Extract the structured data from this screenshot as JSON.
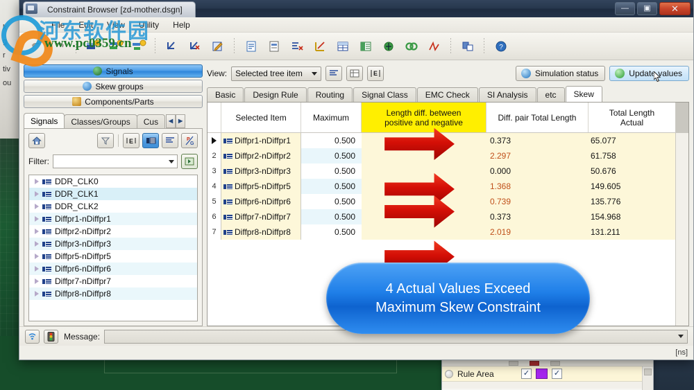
{
  "window": {
    "title": "Constraint Browser [zd-mother.dsgn]",
    "app_icon": "constraint-browser-icon",
    "controls": {
      "minimize": "—",
      "maximize": "▣",
      "close": "✕"
    }
  },
  "menu": {
    "items": [
      "File",
      "Edit",
      "View",
      "Utility",
      "Help"
    ]
  },
  "toolbar": {
    "groups": [
      {
        "buttons": [
          {
            "name": "undo-icon",
            "glyph": "↶"
          },
          {
            "name": "redo-icon",
            "glyph": "↷"
          }
        ]
      },
      {
        "buttons": [
          {
            "name": "new-constraint-icon",
            "glyph": "⚑"
          },
          {
            "name": "edit-constraint-icon",
            "glyph": "⚒"
          },
          {
            "name": "apply-constraint-icon",
            "glyph": "⚐"
          }
        ]
      },
      {
        "buttons": [
          {
            "name": "check-rule-icon",
            "glyph": "✓"
          },
          {
            "name": "clear-rule-icon",
            "glyph": "✗"
          },
          {
            "name": "edit-rule-icon",
            "glyph": "✎"
          }
        ]
      },
      {
        "buttons": [
          {
            "name": "import-icon",
            "glyph": "⇥"
          },
          {
            "name": "export-icon",
            "glyph": "↧"
          },
          {
            "name": "delete-rule-icon",
            "glyph": "✖"
          },
          {
            "name": "length-chart-icon",
            "glyph": "↗"
          },
          {
            "name": "table-view-icon",
            "glyph": "▦"
          },
          {
            "name": "group-view-icon",
            "glyph": "▤"
          },
          {
            "name": "net-icon",
            "glyph": "●"
          },
          {
            "name": "link-net-icon",
            "glyph": "⚭"
          },
          {
            "name": "waveform-icon",
            "glyph": "⌒"
          }
        ]
      },
      {
        "buttons": [
          {
            "name": "layout-icon",
            "glyph": "◫"
          }
        ]
      },
      {
        "buttons": [
          {
            "name": "help-icon",
            "glyph": "?"
          }
        ]
      }
    ]
  },
  "sidebar": {
    "mode_buttons": [
      {
        "label": "Signals",
        "icon": "signals-icon",
        "selected": true,
        "color": "#2f6f3f"
      },
      {
        "label": "Skew groups",
        "icon": "clock-icon",
        "selected": false,
        "color": "#2e79c4"
      },
      {
        "label": "Components/Parts",
        "icon": "component-icon",
        "selected": false,
        "color": "#d08a20"
      }
    ],
    "tabs": [
      {
        "label": "Signals",
        "active": true
      },
      {
        "label": "Classes/Groups",
        "active": false
      },
      {
        "label": "Cus",
        "active": false
      }
    ],
    "tab_scroll": {
      "prev": "◀",
      "next": "▶"
    },
    "tools": [
      {
        "name": "home-button",
        "glyph": "⌂",
        "active": false
      },
      {
        "name": "filter-button",
        "glyph": "∇",
        "active": false
      },
      {
        "name": "expand-all-button",
        "glyph": "E",
        "active": false
      },
      {
        "name": "net-view-button",
        "glyph": "▤",
        "active": true
      },
      {
        "name": "list-view-button",
        "glyph": "≣",
        "active": false
      },
      {
        "name": "pg-toggle-button",
        "glyph": "P/G",
        "active": false
      }
    ],
    "filter": {
      "label": "Filter:",
      "value": "",
      "placeholder": "",
      "apply_icon": "apply-filter-icon"
    },
    "tree_items": [
      {
        "label": "DDR_CLK0",
        "highlighted": false
      },
      {
        "label": "DDR_CLK1",
        "highlighted": true
      },
      {
        "label": "DDR_CLK2",
        "highlighted": false
      },
      {
        "label": "Diffpr1-nDiffpr1",
        "highlighted": false
      },
      {
        "label": "Diffpr2-nDiffpr2",
        "highlighted": false
      },
      {
        "label": "Diffpr3-nDiffpr3",
        "highlighted": false
      },
      {
        "label": "Diffpr5-nDiffpr5",
        "highlighted": false
      },
      {
        "label": "Diffpr6-nDiffpr6",
        "highlighted": false
      },
      {
        "label": "Diffpr7-nDiffpr7",
        "highlighted": false
      },
      {
        "label": "Diffpr8-nDiffpr8",
        "highlighted": false
      }
    ]
  },
  "main": {
    "view": {
      "label": "View:",
      "value": "Selected tree item"
    },
    "view_buttons": [
      {
        "name": "sort-view-button",
        "glyph": "≣"
      },
      {
        "name": "matrix-view-button",
        "glyph": "▦"
      },
      {
        "name": "expand-view-button",
        "glyph": "E"
      }
    ],
    "actions": [
      {
        "label": "Simulation status",
        "icon": "simulation-status-icon",
        "color": "#2f8fd8",
        "hover": false
      },
      {
        "label": "Update values",
        "icon": "update-values-icon",
        "color": "#35b23c",
        "hover": true
      }
    ],
    "tabs": [
      {
        "label": "Basic",
        "active": false
      },
      {
        "label": "Design Rule",
        "active": false
      },
      {
        "label": "Routing",
        "active": false
      },
      {
        "label": "Signal Class",
        "active": false
      },
      {
        "label": "EMC Check",
        "active": false
      },
      {
        "label": "SI Analysis",
        "active": false
      },
      {
        "label": "etc",
        "active": false
      },
      {
        "label": "Skew",
        "active": true
      }
    ]
  },
  "table": {
    "columns": [
      {
        "label": "Selected Item",
        "highlighted": false
      },
      {
        "label": "Maximum",
        "highlighted": false
      },
      {
        "label": "Length diff. between\npositive and negative",
        "highlighted": true
      },
      {
        "label": "Diff. pair Total Length",
        "highlighted": false
      },
      {
        "label": "Total Length\nActual",
        "highlighted": false
      }
    ],
    "rows": [
      {
        "num": "▶",
        "current": true,
        "item": "Diffpr1-nDiffpr1",
        "maximum": "0.500",
        "diff_pair_total": "0.373",
        "total_length_actual": "65.077",
        "exceeds": false
      },
      {
        "num": "2",
        "current": false,
        "item": "Diffpr2-nDiffpr2",
        "maximum": "0.500",
        "diff_pair_total": "2.297",
        "total_length_actual": "61.758",
        "exceeds": true
      },
      {
        "num": "3",
        "current": false,
        "item": "Diffpr3-nDiffpr3",
        "maximum": "0.500",
        "diff_pair_total": "0.000",
        "total_length_actual": "50.676",
        "exceeds": false
      },
      {
        "num": "4",
        "current": false,
        "item": "Diffpr5-nDiffpr5",
        "maximum": "0.500",
        "diff_pair_total": "1.368",
        "total_length_actual": "149.605",
        "exceeds": true
      },
      {
        "num": "5",
        "current": false,
        "item": "Diffpr6-nDiffpr6",
        "maximum": "0.500",
        "diff_pair_total": "0.739",
        "total_length_actual": "135.776",
        "exceeds": true
      },
      {
        "num": "6",
        "current": false,
        "item": "Diffpr7-nDiffpr7",
        "maximum": "0.500",
        "diff_pair_total": "0.373",
        "total_length_actual": "154.968",
        "exceeds": false
      },
      {
        "num": "7",
        "current": false,
        "item": "Diffpr8-nDiffpr8",
        "maximum": "0.500",
        "diff_pair_total": "2.019",
        "total_length_actual": "131.211",
        "exceeds": true
      }
    ]
  },
  "annotation": {
    "callout_text": "4 Actual Values Exceed\nMaximum Skew Constraint",
    "callout_color": "#1f7fe8",
    "arrow_color": "#d01008",
    "arrow_target_rows": [
      2,
      4,
      5,
      7
    ]
  },
  "status": {
    "icons": [
      {
        "name": "signal-status-icon"
      },
      {
        "name": "traffic-light-icon"
      }
    ],
    "message_label": "Message:",
    "message_value": "",
    "unit": "[ns]"
  },
  "background_panel": {
    "row_label": "Rule Area",
    "checkbox_left": "✓",
    "checkbox_right": "✓",
    "swatch_color": "#a626ef"
  },
  "watermark": {
    "site_cn": "河东软件园",
    "site_url": "www.pc0359.cn"
  }
}
